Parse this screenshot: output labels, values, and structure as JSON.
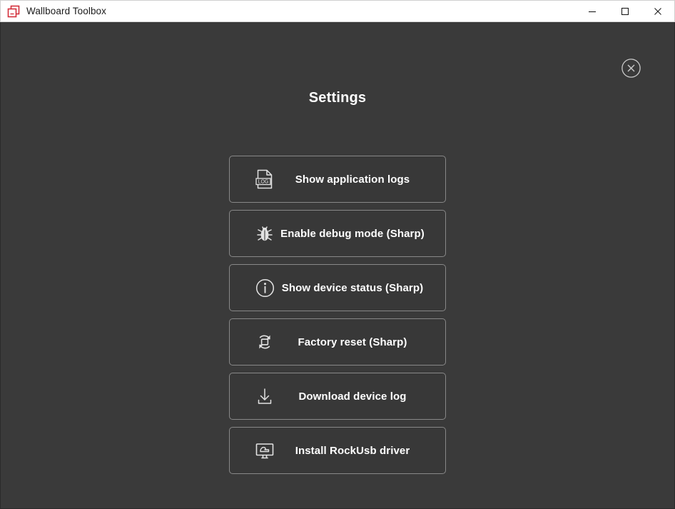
{
  "window": {
    "title": "Wallboard Toolbox",
    "app_icon": "stacked-documents-icon",
    "icon_color": "#d32f3a",
    "background_color": "#3a3a3a",
    "titlebar_background": "#ffffff",
    "controls": {
      "minimize": "minimize-button",
      "maximize": "maximize-button",
      "close": "close-button"
    }
  },
  "content": {
    "close_overlay": "close-circle-icon",
    "title": "Settings",
    "buttons": [
      {
        "label": "Show application logs",
        "icon": "log-file-icon"
      },
      {
        "label": "Enable debug mode (Sharp)",
        "icon": "bug-icon"
      },
      {
        "label": "Show device status (Sharp)",
        "icon": "info-circle-icon"
      },
      {
        "label": "Factory reset (Sharp)",
        "icon": "reset-refresh-icon"
      },
      {
        "label": "Download device log",
        "icon": "download-icon"
      },
      {
        "label": "Install RockUsb driver",
        "icon": "monitor-driver-icon"
      }
    ]
  }
}
